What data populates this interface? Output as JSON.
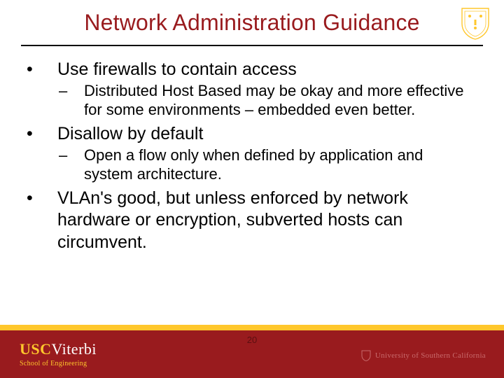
{
  "title": "Network Administration Guidance",
  "bullets": [
    {
      "text": "Use firewalls to contain access",
      "sub": [
        "Distributed Host Based may be okay and more effective for some environments – embedded even better."
      ]
    },
    {
      "text": "Disallow by default",
      "sub": [
        "Open a flow only when defined by application and system architecture."
      ]
    },
    {
      "text": "VLAn's good, but unless enforced by network hardware or encryption, subverted hosts can circumvent.",
      "sub": []
    }
  ],
  "footer": {
    "usc": "USC",
    "viterbi": "Viterbi",
    "school": "School of Engineering",
    "page": "20",
    "university": "University of Southern California"
  },
  "colors": {
    "cardinal": "#991B1E",
    "gold": "#FFC72C"
  }
}
